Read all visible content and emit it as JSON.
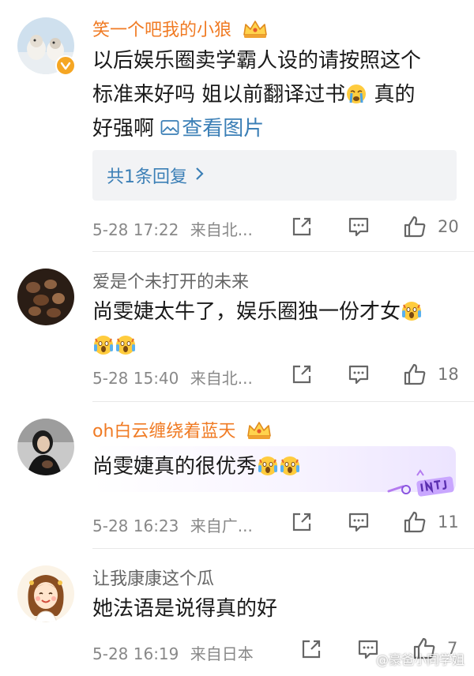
{
  "comments": [
    {
      "username": "笑一个吧我的小狼",
      "badge": "crown-icon",
      "verified": true,
      "content_lines": [
        "以后娱乐圈卖学霸人设的请按照这个",
        "标准来好吗  姐以前翻译过书",
        " 真的",
        "好强啊 "
      ],
      "image_link": "查看图片",
      "reply_summary": "共1条回复",
      "date": "5-28 17:22",
      "location": "来自北...",
      "likes": "20"
    },
    {
      "username": "爱是个未打开的未来",
      "content_lines": [
        "尚雯婕太牛了，娱乐圈独一份才女"
      ],
      "date": "5-28 15:40",
      "location": "来自北...",
      "likes": "18"
    },
    {
      "username": "oh白云缠绕着蓝天",
      "badge": "crown-icon",
      "content_lines": [
        "尚雯婕真的很优秀"
      ],
      "date": "5-28 16:23",
      "location": "来自广...",
      "likes": "11"
    },
    {
      "username": "让我康康这个瓜",
      "content_lines": [
        "她法语是说得真的好"
      ],
      "date": "5-28 16:19",
      "location": "来自日本",
      "likes": "7"
    }
  ],
  "watermark": "@豪爸小同学姐",
  "colors": {
    "vip_name": "#f07b24",
    "link": "#3b7fb6",
    "meta": "#888888",
    "divider": "#e8e8e8"
  }
}
